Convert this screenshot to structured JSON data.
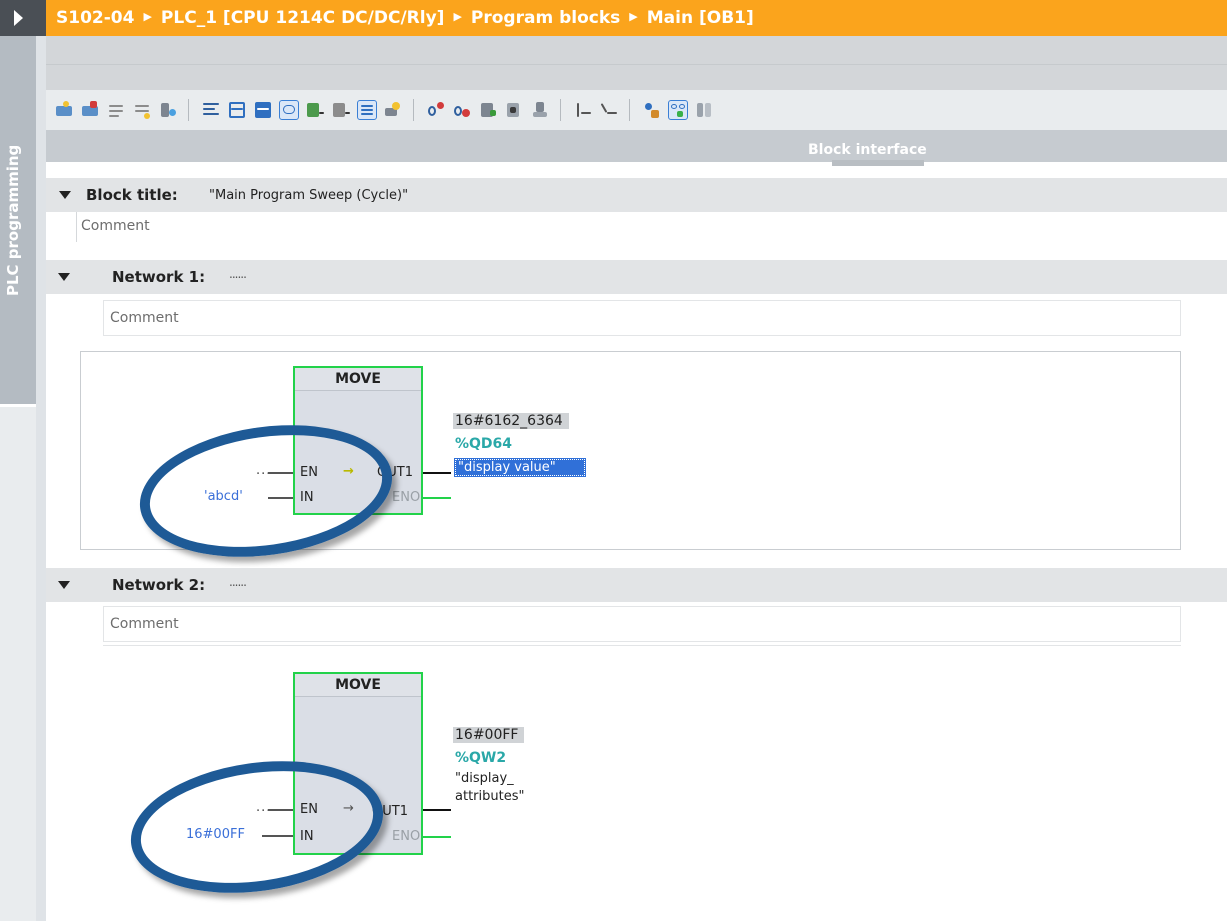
{
  "breadcrumb": [
    "S102-04",
    "PLC_1 [CPU 1214C DC/DC/Rly]",
    "Program blocks",
    "Main [OB1]"
  ],
  "left_tab": {
    "label": "PLC programming"
  },
  "interface_bar": {
    "label": "Block interface"
  },
  "block": {
    "title_label": "Block title:",
    "title_value": "\"Main Program Sweep (Cycle)\"",
    "comment": "Comment"
  },
  "networks": [
    {
      "label": "Network 1:",
      "dots": "......",
      "comment": "Comment",
      "instruction": "MOVE",
      "en_input": "...",
      "in_value": "'abcd'",
      "pin_en": "EN",
      "pin_in": "IN",
      "pin_out": "OUT1",
      "pin_eno": "ENO",
      "out_value": "16#6162_6364",
      "out_address": "%QD64",
      "out_tag": "\"display value\""
    },
    {
      "label": "Network 2:",
      "dots": "......",
      "comment": "Comment",
      "instruction": "MOVE",
      "en_input": "...",
      "in_value": "16#00FF",
      "pin_en": "EN",
      "pin_in": "IN",
      "pin_out": "OUT1",
      "pin_eno": "ENO",
      "out_value": "16#00FF",
      "out_address": "%QW2",
      "out_tag_line1": "\"display_",
      "out_tag_line2": "attributes\""
    }
  ],
  "toolbar_icons": [
    "insert-network-icon",
    "delete-network-icon",
    "insert-row-icon",
    "append-row-icon",
    "reset-start-values-icon",
    "absolute-operands-icon",
    "favorites-icon",
    "networks-expand-icon",
    "networks-collapse-icon",
    "comments-toggle-icon",
    "display-tags-icon",
    "tag-info-icon",
    "show-comments-icon",
    "update-calls-icon",
    "go-to-next-error-icon",
    "go-to-previous-error-icon",
    "update-block-icon",
    "compare-icon",
    "download-icon",
    "first-network-icon",
    "last-network-icon",
    "monitor-icon",
    "glasses-monitor-icon",
    "split-editor-icon"
  ],
  "colors": {
    "title_bar": "#fba41c",
    "rung_active": "#22d24a",
    "highlight_ellipse": "#1e5a96",
    "selected_tag": "#3070d8",
    "address": "#2aa8a8"
  }
}
